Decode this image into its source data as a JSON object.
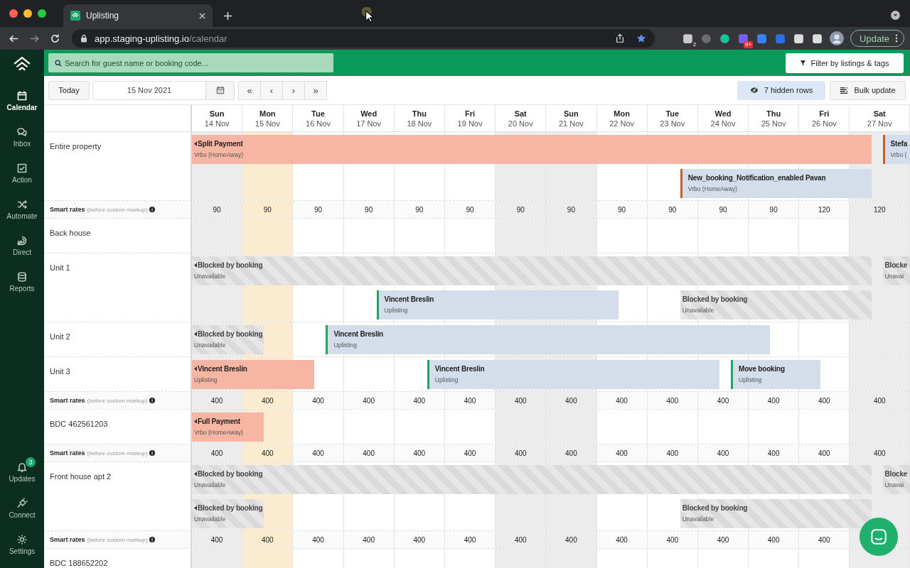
{
  "browser": {
    "tab_title": "Uplisting",
    "url_host": "app.staging-uplisting.io",
    "url_path": "/calendar",
    "update_button": "Update",
    "extensions": [
      {
        "kind": "ghost",
        "badge": "2"
      },
      {
        "kind": "info"
      },
      {
        "kind": "grammar"
      },
      {
        "kind": "spark",
        "badge": "9+"
      },
      {
        "kind": "square"
      },
      {
        "kind": "tag"
      },
      {
        "kind": "puzzle"
      },
      {
        "kind": "flask"
      }
    ]
  },
  "sidebar": {
    "items": [
      {
        "kind": "calendar",
        "label": "Calendar",
        "selected": true
      },
      {
        "kind": "inbox",
        "label": "Inbox",
        "selected": false
      },
      {
        "kind": "action",
        "label": "Action",
        "selected": false
      },
      {
        "kind": "automate",
        "label": "Automate",
        "selected": false
      },
      {
        "kind": "direct",
        "label": "Direct",
        "selected": false
      },
      {
        "kind": "reports",
        "label": "Reports",
        "selected": false
      }
    ],
    "bottom_items": [
      {
        "kind": "updates",
        "label": "Updates",
        "badge": "3",
        "selected": false
      },
      {
        "kind": "connect",
        "label": "Connect",
        "selected": false
      },
      {
        "kind": "settings",
        "label": "Settings",
        "selected": false
      }
    ]
  },
  "search": {
    "placeholder": "Search for guest name or booking code..."
  },
  "filter_button": "Filter by listings & tags",
  "toolbar": {
    "today": "Today",
    "date": "15 Nov 2021",
    "nav": [
      "«",
      "‹",
      "›",
      "»"
    ],
    "hidden_rows": "7 hidden rows",
    "bulk_update": "Bulk update"
  },
  "days": [
    {
      "weekday": "Sun",
      "date": "14 Nov",
      "weekend": true,
      "today": false
    },
    {
      "weekday": "Mon",
      "date": "15 Nov",
      "weekend": false,
      "today": true
    },
    {
      "weekday": "Tue",
      "date": "16 Nov",
      "weekend": false,
      "today": false
    },
    {
      "weekday": "Wed",
      "date": "17 Nov",
      "weekend": false,
      "today": false
    },
    {
      "weekday": "Thu",
      "date": "18 Nov",
      "weekend": false,
      "today": false
    },
    {
      "weekday": "Fri",
      "date": "19 Nov",
      "weekend": false,
      "today": false
    },
    {
      "weekday": "Sat",
      "date": "20 Nov",
      "weekend": true,
      "today": false
    },
    {
      "weekday": "Sun",
      "date": "21 Nov",
      "weekend": true,
      "today": false
    },
    {
      "weekday": "Mon",
      "date": "22 Nov",
      "weekend": false,
      "today": false
    },
    {
      "weekday": "Tue",
      "date": "23 Nov",
      "weekend": false,
      "today": false
    },
    {
      "weekday": "Wed",
      "date": "24 Nov",
      "weekend": false,
      "today": false
    },
    {
      "weekday": "Thu",
      "date": "25 Nov",
      "weekend": false,
      "today": false
    },
    {
      "weekday": "Fri",
      "date": "26 Nov",
      "weekend": false,
      "today": false
    },
    {
      "weekday": "Sat",
      "date": "27 Nov",
      "weekend": true,
      "today": false
    }
  ],
  "rows": [
    {
      "kind": "listing",
      "name": "Entire property",
      "lanes": [
        [
          {
            "kind": "current",
            "title": "Split Payment",
            "source": "Vrbo (HomeAway)",
            "before": true,
            "after": false
          },
          {
            "kind": "stay",
            "title": "Stefa",
            "source": "Vrbo (",
            "color": "#c0612b",
            "before": false,
            "after": true
          }
        ],
        [
          {
            "kind": "stay",
            "title": "New_booking_Notification_enabled Pavan",
            "source": "Vrbo (HomeAway)",
            "color": "#c0612b",
            "before": false,
            "after": false
          }
        ]
      ]
    },
    {
      "kind": "rates",
      "label": "Smart rates",
      "note": "(before custom markup)",
      "values": [
        "90",
        "90",
        "90",
        "90",
        "90",
        "90",
        "90",
        "90",
        "90",
        "90",
        "90",
        "90",
        "120",
        "120"
      ]
    },
    {
      "kind": "listing",
      "name": "Back house"
    },
    {
      "kind": "listing",
      "name": "Unit 1",
      "lanes": [
        [
          {
            "kind": "blocked",
            "title": "Blocked by booking",
            "source": "Unavailable",
            "before": true,
            "after": false
          },
          {
            "kind": "blocked",
            "title": "Blocke",
            "source": "Unavai",
            "before": false,
            "after": true
          }
        ],
        [
          {
            "kind": "stay",
            "title": "Vincent Breslin",
            "source": "Uplisting",
            "color": "#27a162",
            "before": false,
            "after": false
          },
          {
            "kind": "blocked",
            "title": "Blocked by booking",
            "source": "Unavailable",
            "before": false,
            "after": false
          }
        ]
      ]
    },
    {
      "kind": "listing",
      "name": "Unit 2",
      "lanes": [
        [
          {
            "kind": "blocked",
            "title": "Blocked by booking",
            "source": "Unavailable",
            "before": true,
            "after": false
          },
          {
            "kind": "stay",
            "title": "Vincent Breslin",
            "source": "Uplisting",
            "color": "#27a162",
            "before": false,
            "after": false
          }
        ]
      ]
    },
    {
      "kind": "listing",
      "name": "Unit 3",
      "lanes": [
        [
          {
            "kind": "current",
            "title": "Vincent Breslin",
            "source": "Uplisting",
            "before": true,
            "after": false
          },
          {
            "kind": "stay",
            "title": "Vincent Breslin",
            "source": "Uplisting",
            "color": "#27a162",
            "before": false,
            "after": false
          },
          {
            "kind": "stay",
            "title": "Move booking",
            "source": "Uplisting",
            "color": "#27a162",
            "before": false,
            "after": false
          }
        ]
      ]
    },
    {
      "kind": "rates",
      "label": "Smart rates",
      "note": "(before custom markup)",
      "values": [
        "400",
        "400",
        "400",
        "400",
        "400",
        "400",
        "400",
        "400",
        "400",
        "400",
        "400",
        "400",
        "400",
        "400"
      ]
    },
    {
      "kind": "listing",
      "name": "BDC 462561203",
      "lanes": [
        [
          {
            "kind": "current",
            "title": "Full Payment",
            "source": "Vrbo (HomeAway)",
            "before": true,
            "after": false
          }
        ]
      ]
    },
    {
      "kind": "rates",
      "label": "Smart rates",
      "note": "(before custom markup)",
      "values": [
        "400",
        "400",
        "400",
        "400",
        "400",
        "400",
        "400",
        "400",
        "400",
        "400",
        "400",
        "400",
        "400",
        "400"
      ]
    },
    {
      "kind": "listing",
      "name": "Front house apt 2",
      "lanes": [
        [
          {
            "kind": "blocked",
            "title": "Blocked by booking",
            "source": "Unavailable",
            "before": true,
            "after": false
          },
          {
            "kind": "blocked",
            "title": "Blocke",
            "source": "Unavai",
            "before": false,
            "after": true
          }
        ],
        [
          {
            "kind": "blocked",
            "title": "Blocked by booking",
            "source": "Unavailable",
            "before": true,
            "after": false
          },
          {
            "kind": "blocked",
            "title": "Blocked by booking",
            "source": "Unavailable",
            "before": false,
            "after": false
          }
        ]
      ]
    },
    {
      "kind": "rates",
      "label": "Smart rates",
      "note": "(before custom markup)",
      "values": [
        "400",
        "400",
        "400",
        "400",
        "400",
        "400",
        "400",
        "400",
        "400",
        "400",
        "400",
        "400",
        "400"
      ]
    },
    {
      "kind": "listing",
      "name": "BDC 188652202"
    }
  ]
}
